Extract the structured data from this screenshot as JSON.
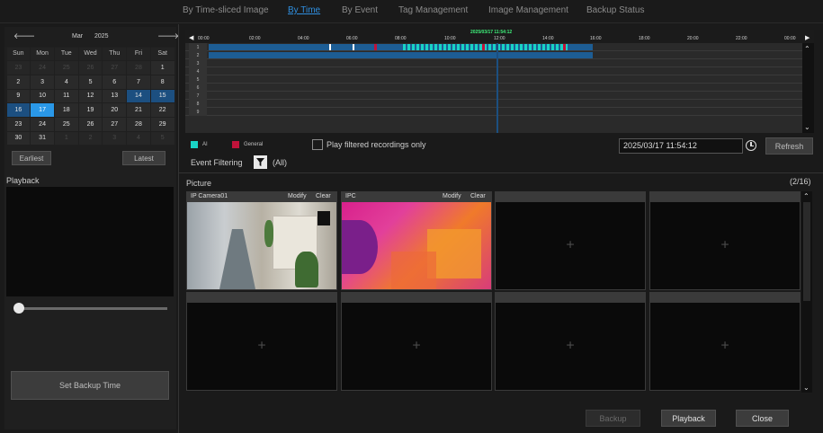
{
  "tabs": [
    {
      "label": "By Time-sliced Image"
    },
    {
      "label": "By Time"
    },
    {
      "label": "By Event"
    },
    {
      "label": "Tag Management"
    },
    {
      "label": "Image Management"
    },
    {
      "label": "Backup Status"
    }
  ],
  "calendar": {
    "month": "Mar",
    "year": "2025",
    "weekdays": [
      "Sun",
      "Mon",
      "Tue",
      "Wed",
      "Thu",
      "Fri",
      "Sat"
    ],
    "weeks": [
      [
        "23",
        "24",
        "25",
        "26",
        "27",
        "28",
        "1"
      ],
      [
        "2",
        "3",
        "4",
        "5",
        "6",
        "7",
        "8"
      ],
      [
        "9",
        "10",
        "11",
        "12",
        "13",
        "14",
        "15"
      ],
      [
        "16",
        "17",
        "18",
        "19",
        "20",
        "21",
        "22"
      ],
      [
        "23",
        "24",
        "25",
        "26",
        "27",
        "28",
        "29"
      ],
      [
        "30",
        "31",
        "1",
        "2",
        "3",
        "4",
        "5"
      ]
    ],
    "earliest_label": "Earliest",
    "latest_label": "Latest"
  },
  "playback": {
    "label": "Playback",
    "set_backup_time_label": "Set Backup Time"
  },
  "timeline": {
    "current_time_label": "2025/03/17 11:54:12",
    "ticks": [
      "00:00",
      "02:00",
      "04:00",
      "06:00",
      "08:00",
      "10:00",
      "12:00",
      "14:00",
      "16:00",
      "18:00",
      "20:00",
      "22:00",
      "00:00"
    ],
    "rows": [
      "1",
      "2",
      "3",
      "4",
      "5",
      "6",
      "7",
      "8",
      "9"
    ]
  },
  "legend": {
    "ai_label": "AI",
    "ai_color": "#19d3c5",
    "general_label": "General",
    "general_color": "#c0133a"
  },
  "filters": {
    "play_filtered_label": "Play filtered recordings only",
    "event_filtering_label": "Event Filtering",
    "event_filtering_value": "(All)",
    "datetime_value": "2025/03/17 11:54:12",
    "refresh_label": "Refresh"
  },
  "picture": {
    "label": "Picture",
    "page": "(2/16)",
    "cells": [
      {
        "name": "IP Camera01",
        "modify": "Modify",
        "clear": "Clear"
      },
      {
        "name": "IPC",
        "modify": "Modify",
        "clear": "Clear"
      }
    ]
  },
  "footer": {
    "backup_label": "Backup",
    "playback_label": "Playback",
    "close_label": "Close"
  }
}
